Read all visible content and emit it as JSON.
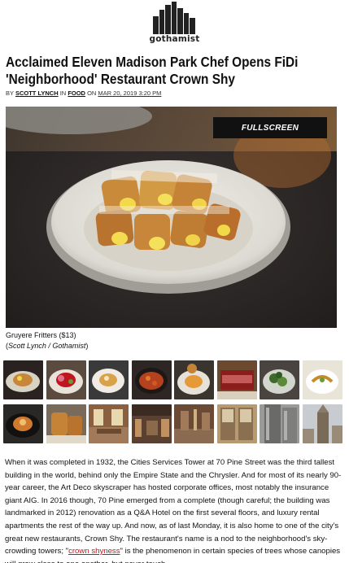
{
  "site": {
    "logo_text": "gothamist",
    "logo_icon": "skyline-icon"
  },
  "article": {
    "title": "Acclaimed Eleven Madison Park Chef Opens FiDi 'Neighborhood' Restaurant Crown Shy",
    "byline": {
      "by": "BY",
      "author": "SCOTT LYNCH",
      "in": "IN",
      "section": "FOOD",
      "on": "ON",
      "date": "MAR 20, 2019 3:20 PM"
    },
    "hero": {
      "fullscreen_label": "FULLSCREEN"
    },
    "caption": {
      "text": "Gruyere Fritters ($13)",
      "credit": "Scott Lynch / Gothamist"
    },
    "body": {
      "before_link": "When it was completed in 1932, the Cities Services Tower at 70 Pine Street was the third tallest building in the world, behind only the Empire State and the Chrysler. And for most of its nearly 90-year career, the Art Deco skyscraper has hosted corporate offices, most notably the insurance giant AIG. In 2016 though, 70 Pine emerged from a complete (though careful; the building was landmarked in 2012) renovation as a Q&A Hotel on the first several floors, and luxury rental apartments the rest of the way up. And now, as of last Monday, it is also home to one of the city's great new restaurants, Crown Shy. The restaurant's name is a nod to the neighborhood's sky-crowding towers; \"",
      "link": "crown shyness",
      "after_link": "\" is the phenomenon in certain species of trees whose canopies will grow close to one another, but never touch."
    }
  },
  "gallery": {
    "colors": [
      "#8b1d1d",
      "#b00020",
      "#c0151f",
      "#e9e4d8",
      "#3a3a3a",
      "#6b4a2f"
    ],
    "thumbnails": [
      {
        "label": "thumbnail-1"
      },
      {
        "label": "thumbnail-2"
      },
      {
        "label": "thumbnail-3"
      },
      {
        "label": "thumbnail-4"
      },
      {
        "label": "thumbnail-5"
      },
      {
        "label": "thumbnail-6"
      },
      {
        "label": "thumbnail-7"
      },
      {
        "label": "thumbnail-8"
      },
      {
        "label": "thumbnail-9"
      },
      {
        "label": "thumbnail-10"
      },
      {
        "label": "thumbnail-11"
      },
      {
        "label": "thumbnail-12"
      },
      {
        "label": "thumbnail-13"
      },
      {
        "label": "thumbnail-14"
      },
      {
        "label": "thumbnail-15"
      },
      {
        "label": "thumbnail-16"
      }
    ]
  }
}
